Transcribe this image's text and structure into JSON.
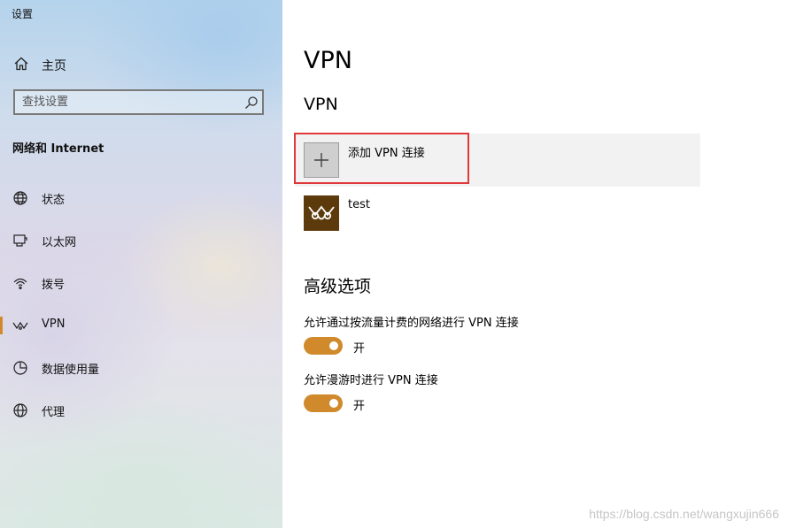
{
  "window": {
    "title": "设置"
  },
  "sidebar": {
    "home": {
      "label": "主页",
      "icon": "home-icon"
    },
    "search": {
      "placeholder": "查找设置",
      "icon": "search-icon"
    },
    "section_title": "网络和 Internet",
    "items": [
      {
        "label": "状态",
        "icon": "status-globe-icon",
        "selected": false
      },
      {
        "label": "以太网",
        "icon": "ethernet-icon",
        "selected": false
      },
      {
        "label": "拨号",
        "icon": "dialup-icon",
        "selected": false
      },
      {
        "label": "VPN",
        "icon": "vpn-icon",
        "selected": true
      },
      {
        "label": "数据使用量",
        "icon": "data-usage-icon",
        "selected": false
      },
      {
        "label": "代理",
        "icon": "proxy-globe-icon",
        "selected": false
      }
    ],
    "accent_color": "#d08a2c"
  },
  "main": {
    "title": "VPN",
    "subtitle": "VPN",
    "add_vpn": {
      "label": "添加 VPN 连接",
      "icon": "plus-icon"
    },
    "vpn_connections": [
      {
        "name": "test",
        "icon": "vpn-connection-icon"
      }
    ],
    "advanced": {
      "title": "高级选项",
      "options": [
        {
          "label": "允许通过按流量计费的网络进行 VPN 连接",
          "state": "开",
          "on": true
        },
        {
          "label": "允许漫游时进行 VPN 连接",
          "state": "开",
          "on": true
        }
      ]
    },
    "highlight_color": "#e0393b",
    "toggle_color": "#d08a2c"
  },
  "watermark": "https://blog.csdn.net/wangxujin666"
}
